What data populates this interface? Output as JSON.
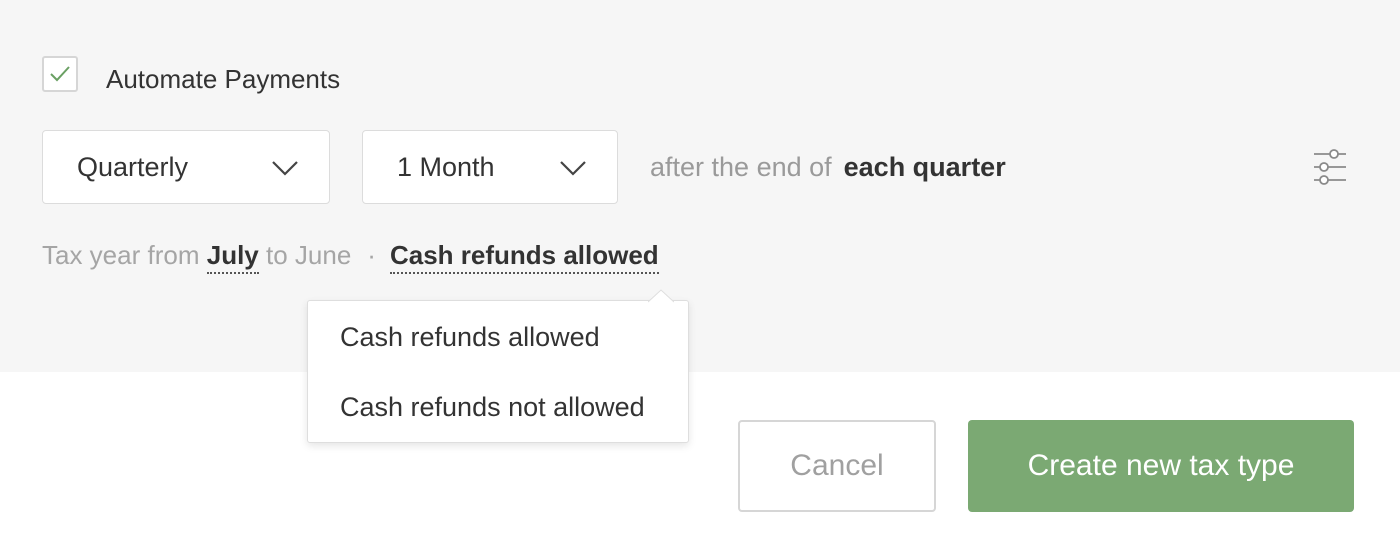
{
  "automate": {
    "label": "Automate Payments",
    "checked": true
  },
  "schedule": {
    "frequency": "Quarterly",
    "offset": "1 Month",
    "after_text": "after the end of",
    "period_text": "each quarter"
  },
  "tax_year": {
    "prefix": "Tax year from",
    "start_month": "July",
    "connector": "to June",
    "separator": "·",
    "refund_policy": "Cash refunds allowed"
  },
  "refund_dropdown": {
    "options": [
      "Cash refunds allowed",
      "Cash refunds not allowed"
    ]
  },
  "actions": {
    "cancel_label": "Cancel",
    "create_label": "Create new tax type"
  },
  "icons": {
    "checkbox": "check-icon",
    "select": "chevron-down-icon",
    "settings": "sliders-icon"
  },
  "colors": {
    "accent_green": "#7ba973",
    "check_green": "#6aa063",
    "panel_bg": "#f6f6f6"
  }
}
